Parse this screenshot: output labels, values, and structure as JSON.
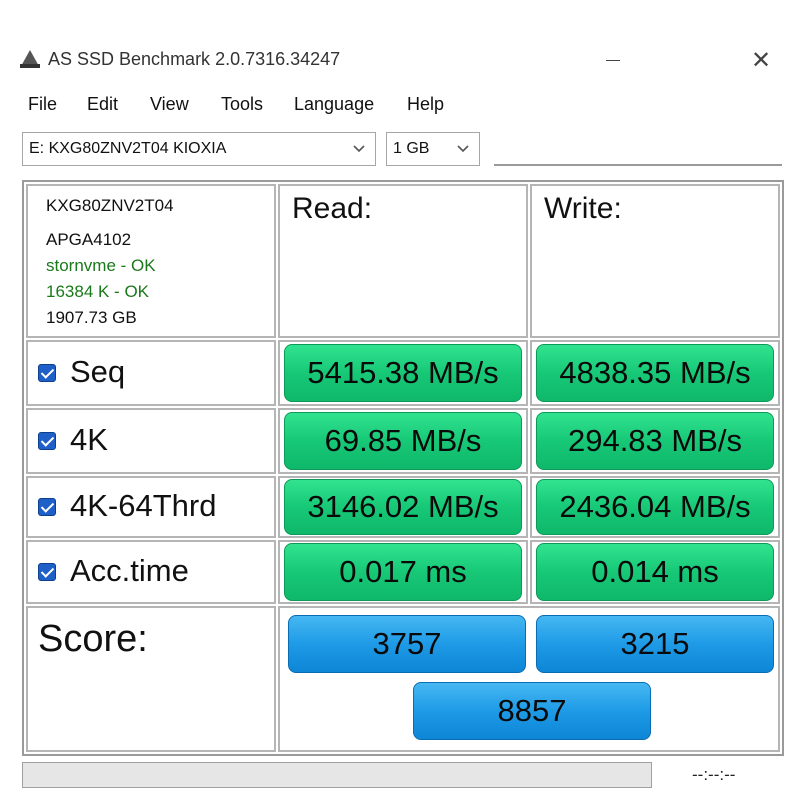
{
  "window": {
    "title": "AS SSD Benchmark 2.0.7316.34247",
    "icon": "app-icon"
  },
  "menu": [
    "File",
    "Edit",
    "View",
    "Tools",
    "Language",
    "Help"
  ],
  "toolbar": {
    "drive_select": "E: KXG80ZNV2T04 KIOXIA",
    "size_select": "1 GB",
    "status_text": ""
  },
  "drive_info": {
    "model": "KXG80ZNV2T04",
    "firmware": "APGA4102",
    "driver": "stornvme - OK",
    "alignment": "16384 K - OK",
    "capacity": "1907.73 GB"
  },
  "headers": {
    "read": "Read:",
    "write": "Write:"
  },
  "tests": [
    {
      "label": "Seq",
      "checked": true,
      "read": "5415.38 MB/s",
      "write": "4838.35 MB/s"
    },
    {
      "label": "4K",
      "checked": true,
      "read": "69.85 MB/s",
      "write": "294.83 MB/s"
    },
    {
      "label": "4K-64Thrd",
      "checked": true,
      "read": "3146.02 MB/s",
      "write": "2436.04 MB/s"
    },
    {
      "label": "Acc.time",
      "checked": true,
      "read": "0.017 ms",
      "write": "0.014 ms"
    }
  ],
  "score": {
    "label": "Score:",
    "read": "3757",
    "write": "3215",
    "total": "8857"
  },
  "status": {
    "progress": 0,
    "elapsed": "--:--:--"
  },
  "colors": {
    "ok_text": "#1a7a1a",
    "result_green": "#17c877",
    "score_blue": "#1e9ae6",
    "checkbox_blue": "#1f5fc8"
  }
}
